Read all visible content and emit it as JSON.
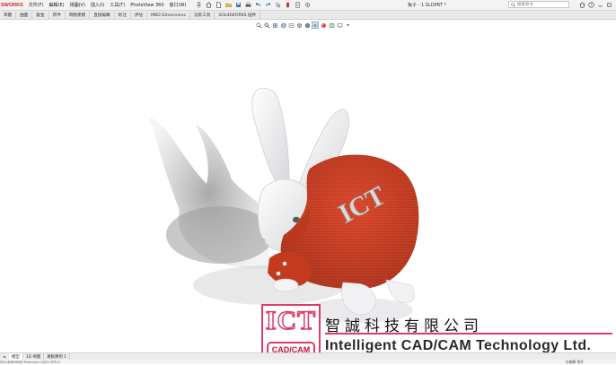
{
  "app": {
    "brand": "SWORKS",
    "document_title": "兔子 - 1.SLDPRT *"
  },
  "menu": [
    "文件(F)",
    "編輯(E)",
    "視圖(V)",
    "插入(I)",
    "工具(T)",
    "PhotoView 360",
    "窗口(W)"
  ],
  "search": {
    "placeholder": "搜索命令"
  },
  "tabs": [
    "草圖",
    "曲面",
    "鈑金",
    "焊件",
    "网格建模",
    "直接編輯",
    "标注",
    "評估",
    "MBD Dimensions",
    "渲染工具",
    "SOLIDWORKS 插件"
  ],
  "active_tab_index": -1,
  "hud_icons": [
    "zoom-to-fit-icon",
    "zoom-area-icon",
    "previous-view-icon",
    "section-view-icon",
    "dynamic-annotation-icon",
    "view-orientation-icon",
    "display-style-icon",
    "hide-show-icon",
    "edit-appearance-icon",
    "apply-scene-icon",
    "view-settings-icon",
    "display-pane-icon"
  ],
  "model_tabs": [
    "模型",
    "3D 視圖",
    "運動算例 1"
  ],
  "status": {
    "left": "SOLIDWORKS Premium 2022 SP5.0",
    "right": "在編輯 零件"
  },
  "model": {
    "shirt_text": "ICT",
    "colors": {
      "body": "#f2f2f4",
      "shirt": "#cc3b1e",
      "shirt_dark": "#a12a12",
      "shadow": "#9a9a9a",
      "eye": "#5a5a5a"
    }
  },
  "watermark": {
    "logo_text": "ICT",
    "logo_sub": "CAD/CAM",
    "company_cn": "智誠科技有限公司",
    "company_en": "Intelligent CAD/CAM Technology Ltd.",
    "accent": "#e03a6a"
  }
}
